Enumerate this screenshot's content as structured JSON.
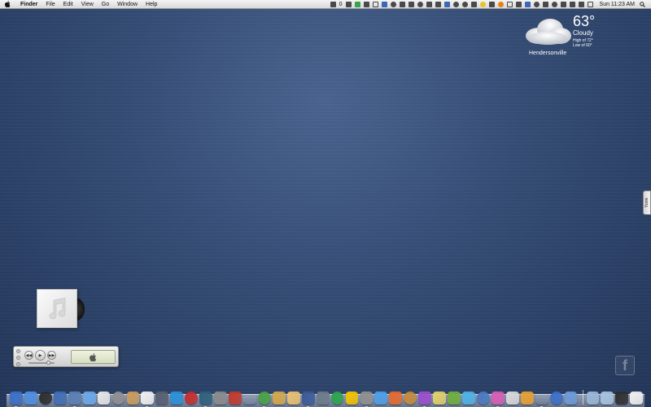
{
  "menubar": {
    "apple_icon": "apple-icon",
    "menus": [
      "Finder",
      "File",
      "Edit",
      "View",
      "Go",
      "Window",
      "Help"
    ],
    "status_text": "0",
    "status_icons": [
      {
        "name": "disk-icon",
        "style": ""
      },
      {
        "name": "battery-icon",
        "style": "green"
      },
      {
        "name": "music-note-icon",
        "style": ""
      },
      {
        "name": "monitor-icon",
        "style": "outline"
      },
      {
        "name": "shield-icon",
        "style": "blue"
      },
      {
        "name": "settings-icon",
        "style": "round"
      },
      {
        "name": "cloud-icon",
        "style": ""
      },
      {
        "name": "tools-icon",
        "style": ""
      },
      {
        "name": "clock-icon",
        "style": "round"
      },
      {
        "name": "grid-icon",
        "style": ""
      },
      {
        "name": "box-icon",
        "style": ""
      },
      {
        "name": "facebook-icon",
        "style": "blue"
      },
      {
        "name": "circle-icon",
        "style": "round"
      },
      {
        "name": "skype-icon",
        "style": "round"
      },
      {
        "name": "stats-icon",
        "style": ""
      },
      {
        "name": "yellow-dot-icon",
        "style": "yellow round"
      },
      {
        "name": "drive-icon",
        "style": ""
      },
      {
        "name": "wifi-orange-icon",
        "style": "orange round"
      },
      {
        "name": "window-icon",
        "style": "outline"
      },
      {
        "name": "box2-icon",
        "style": ""
      },
      {
        "name": "facebook2-icon",
        "style": "blue"
      },
      {
        "name": "sync-icon",
        "style": "round"
      },
      {
        "name": "square-icon",
        "style": ""
      },
      {
        "name": "time-machine-icon",
        "style": "round"
      },
      {
        "name": "bluetooth-icon",
        "style": ""
      },
      {
        "name": "wifi-icon",
        "style": ""
      },
      {
        "name": "volume-icon",
        "style": ""
      },
      {
        "name": "battery-level-icon",
        "style": "outline"
      }
    ],
    "clock": "Sun 11:23 AM",
    "spotlight_icon": "spotlight-icon"
  },
  "weather": {
    "temp": "63°",
    "condition": "Cloudy",
    "high": "High of 72°",
    "low": "Low of 60°",
    "city": "Hendersonville"
  },
  "side_tab": {
    "label": "Yoink"
  },
  "album_art": {
    "icon": "music-note-icon"
  },
  "mini_player": {
    "controls": [
      "rewind-icon",
      "play-icon",
      "fast-forward-icon"
    ],
    "display_icon": "apple-logo-icon"
  },
  "watermark": {
    "label": "f"
  },
  "dock": {
    "left_colors": [
      "#3a6fc7",
      "#4d8ee0",
      "#2b2b2b",
      "#3f6db5",
      "#5a7fb4",
      "#6ba8ea",
      "#e6e6e6",
      "#8f8f8f",
      "#c99b5b",
      "#f0f0f0",
      "#555e70",
      "#2a8fd9",
      "#c62b2b",
      "#2c5f7a",
      "#8a8a8a",
      "#c0392b",
      "#a33",
      "#49a043",
      "#d4a84a",
      "#e8c171",
      "#3b5998",
      "#6c7a89",
      "#2aa44a",
      "#f2c200",
      "#8f8f8f",
      "#4c9ee8",
      "#e36a2e",
      "#c58a3a",
      "#9a4dcc",
      "#e1d06a",
      "#6fae3c",
      "#4db3e6",
      "#4a79c0",
      "#d85db5",
      "#d9d9d9",
      "#e8a030",
      "#333",
      "#3a6fc7",
      "#6b9bd8"
    ],
    "right_colors": [
      "#9ab7d8",
      "#a7c3e0",
      "#2d2d2d",
      "#f0f0f0"
    ],
    "running_indices": [
      0,
      4,
      9,
      13,
      17,
      20,
      24,
      28,
      33,
      36
    ]
  }
}
